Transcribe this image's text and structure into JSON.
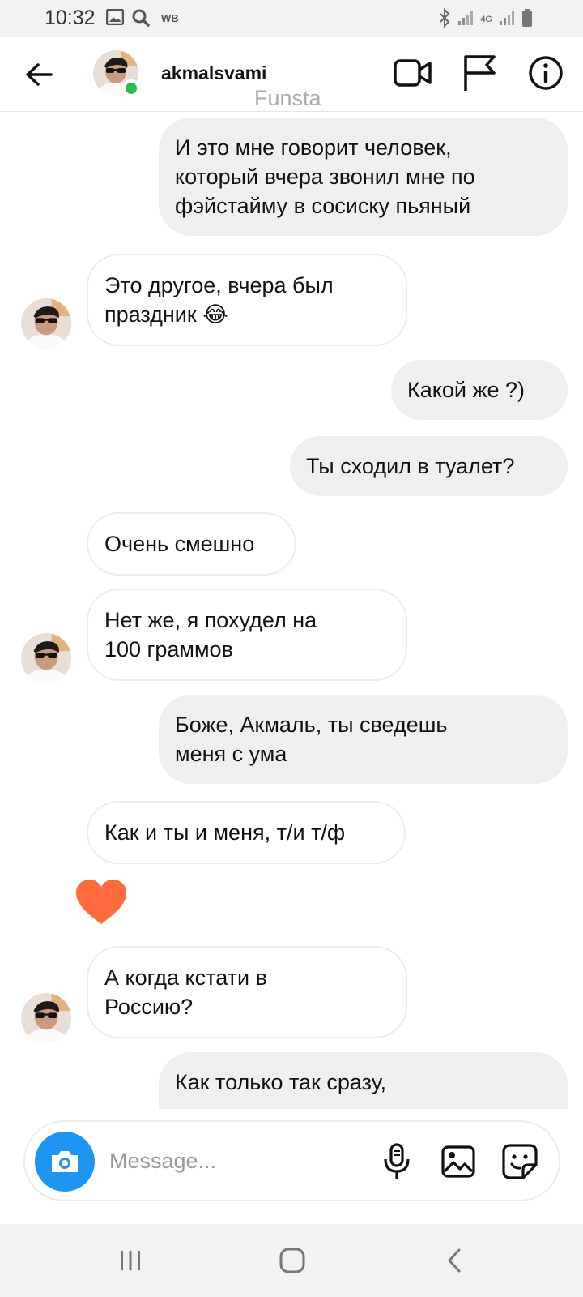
{
  "status_bar": {
    "time": "10:32",
    "carrier_badge": "WB",
    "network": "4G",
    "icons": [
      "gallery-icon",
      "search-icon",
      "bluetooth-icon",
      "signal-icon",
      "battery-icon"
    ]
  },
  "header": {
    "username": "akmalsvami",
    "subtitle": "Funsta",
    "icons": [
      "back-arrow-icon",
      "video-call-icon",
      "flag-icon",
      "info-icon"
    ],
    "online_color": "#2dbd4f"
  },
  "messages": [
    {
      "direction": "outgoing",
      "lines": [
        "И это мне говорит человек,",
        "который вчера звонил мне по",
        "фэйстайму в сосиску пьяный"
      ]
    },
    {
      "direction": "incoming",
      "lines": [
        "Это другое, вчера был",
        "праздник 😂"
      ]
    },
    {
      "direction": "outgoing",
      "lines": [
        "Какой же ?)"
      ]
    },
    {
      "direction": "outgoing",
      "lines": [
        "Ты сходил в туалет?"
      ]
    },
    {
      "direction": "incoming",
      "lines": [
        "Очень смешно"
      ]
    },
    {
      "direction": "incoming",
      "lines": [
        "Нет же, я похудел на",
        "100 граммов"
      ]
    },
    {
      "direction": "outgoing",
      "lines": [
        "Боже, Акмаль, ты сведешь",
        "меня с ума"
      ]
    },
    {
      "direction": "incoming",
      "lines": [
        "Как и ты и меня, т/и т/ф"
      ]
    },
    {
      "direction": "incoming",
      "lines": [
        "А когда кстати в",
        "Россию?"
      ]
    },
    {
      "direction": "outgoing",
      "lines": [
        "Как только так сразу,"
      ]
    }
  ],
  "reaction": {
    "icon": "heart-icon",
    "color": "#ff6b3d"
  },
  "composer": {
    "placeholder": "Message...",
    "icons": [
      "camera-icon",
      "microphone-icon",
      "gallery-icon",
      "sticker-icon"
    ],
    "accent": "#1d96f1"
  },
  "nav_bar": {
    "icons": [
      "recent-apps-icon",
      "home-icon",
      "back-icon"
    ]
  }
}
